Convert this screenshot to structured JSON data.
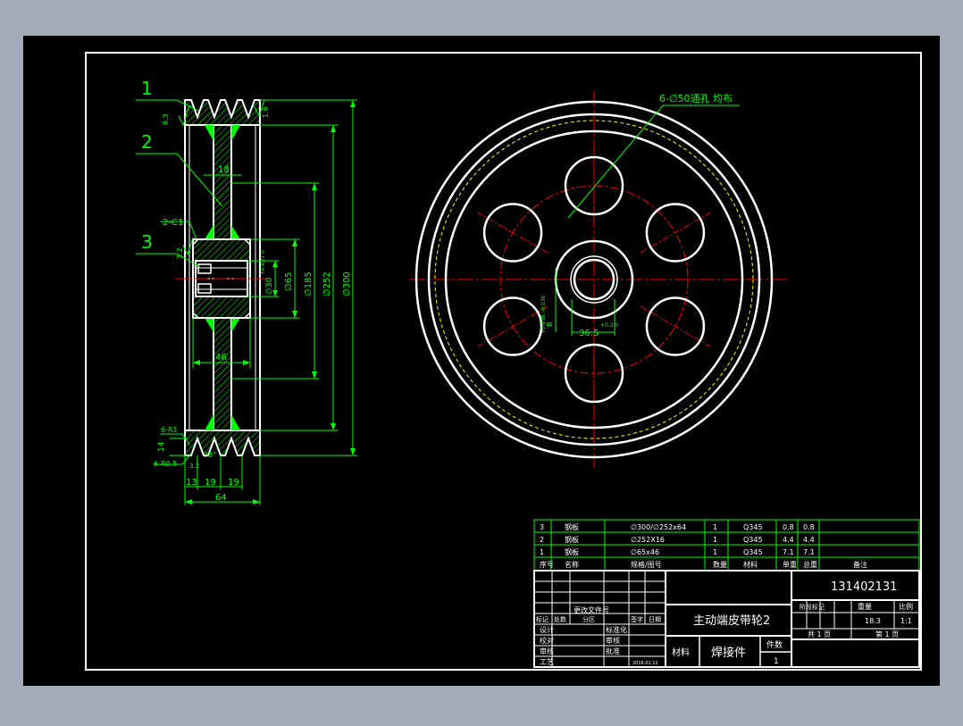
{
  "colors": {
    "background": "#a3abbb",
    "paper": "#000000",
    "frame": "#ffffff",
    "dimension": "#00ff00",
    "centerline": "#ff0000",
    "hidden": "#ffff00",
    "hatch": "#00ff00"
  },
  "side_view": {
    "part_labels": [
      "1",
      "2",
      "3"
    ],
    "chamfer_label": "2-C1",
    "chamfer_label_bottom": "6-R1",
    "groove_label": "6-R0.5",
    "roughness_a": "6.3",
    "roughness_b": "1.6",
    "roughness_c": "3.2",
    "rough_small": "3.2",
    "angle": "38°",
    "dim_web": "18",
    "dim_hub": "46",
    "dim_14": "14",
    "dim_13": "13",
    "dim_19a": "19",
    "dim_19b": "19",
    "dim_64": "64",
    "dia_30": "∅30",
    "dia_30_tol": "+0.021 0",
    "dia_65": "∅65",
    "dia_185": "∅185",
    "dia_252": "∅252",
    "dia_300": "∅300"
  },
  "front_view": {
    "holes_note": "6-∅50通孔 均布",
    "keyway_width": "8",
    "keyway_tol": "+0.036 -0.036",
    "keyway_depth": "36.5",
    "keyway_depth_tol": "+0.2 0"
  },
  "bom": {
    "rows": [
      {
        "no": "3",
        "name": "钢板",
        "spec": "∅300/∅252x64",
        "qty": "1",
        "mat": "Q345",
        "unit": "0.8",
        "total": "0.8",
        "note": ""
      },
      {
        "no": "2",
        "name": "钢板",
        "spec": "∅252X16",
        "qty": "1",
        "mat": "Q345",
        "unit": "4.4",
        "total": "4.4",
        "note": ""
      },
      {
        "no": "1",
        "name": "钢板",
        "spec": "∅65x46",
        "qty": "1",
        "mat": "Q345",
        "unit": "7.1",
        "total": "7.1",
        "note": ""
      }
    ],
    "header": {
      "no": "序号",
      "name": "名称",
      "spec": "规格/图号",
      "qty": "数量",
      "mat": "材料",
      "unit": "单重",
      "total": "总重",
      "note": "备注"
    }
  },
  "title_block": {
    "drawing_no": "131402131",
    "title": "主动端皮带轮2",
    "material_label": "材料",
    "material_value": "焊接件",
    "pieces_label": "件数",
    "pieces_value": "1",
    "stage_header": "阶段标记",
    "weight_header": "重量",
    "scale_header": "比例",
    "weight": "18.3",
    "scale": "1:1",
    "sheet_total": "共 1 页",
    "sheet_no": "第 1 页",
    "rev_table_label": "更改文件号",
    "sign_label": "签字",
    "date_label": "日期",
    "mark_label": "标记",
    "count_label": "处数",
    "zone_label": "分区",
    "design_label": "设计",
    "std_label": "标准化",
    "check_label": "校对",
    "review_label": "审核",
    "process_label": "工艺",
    "approve_label": "批准",
    "proofread_label": "审核",
    "date_value": "2016.01.12"
  }
}
